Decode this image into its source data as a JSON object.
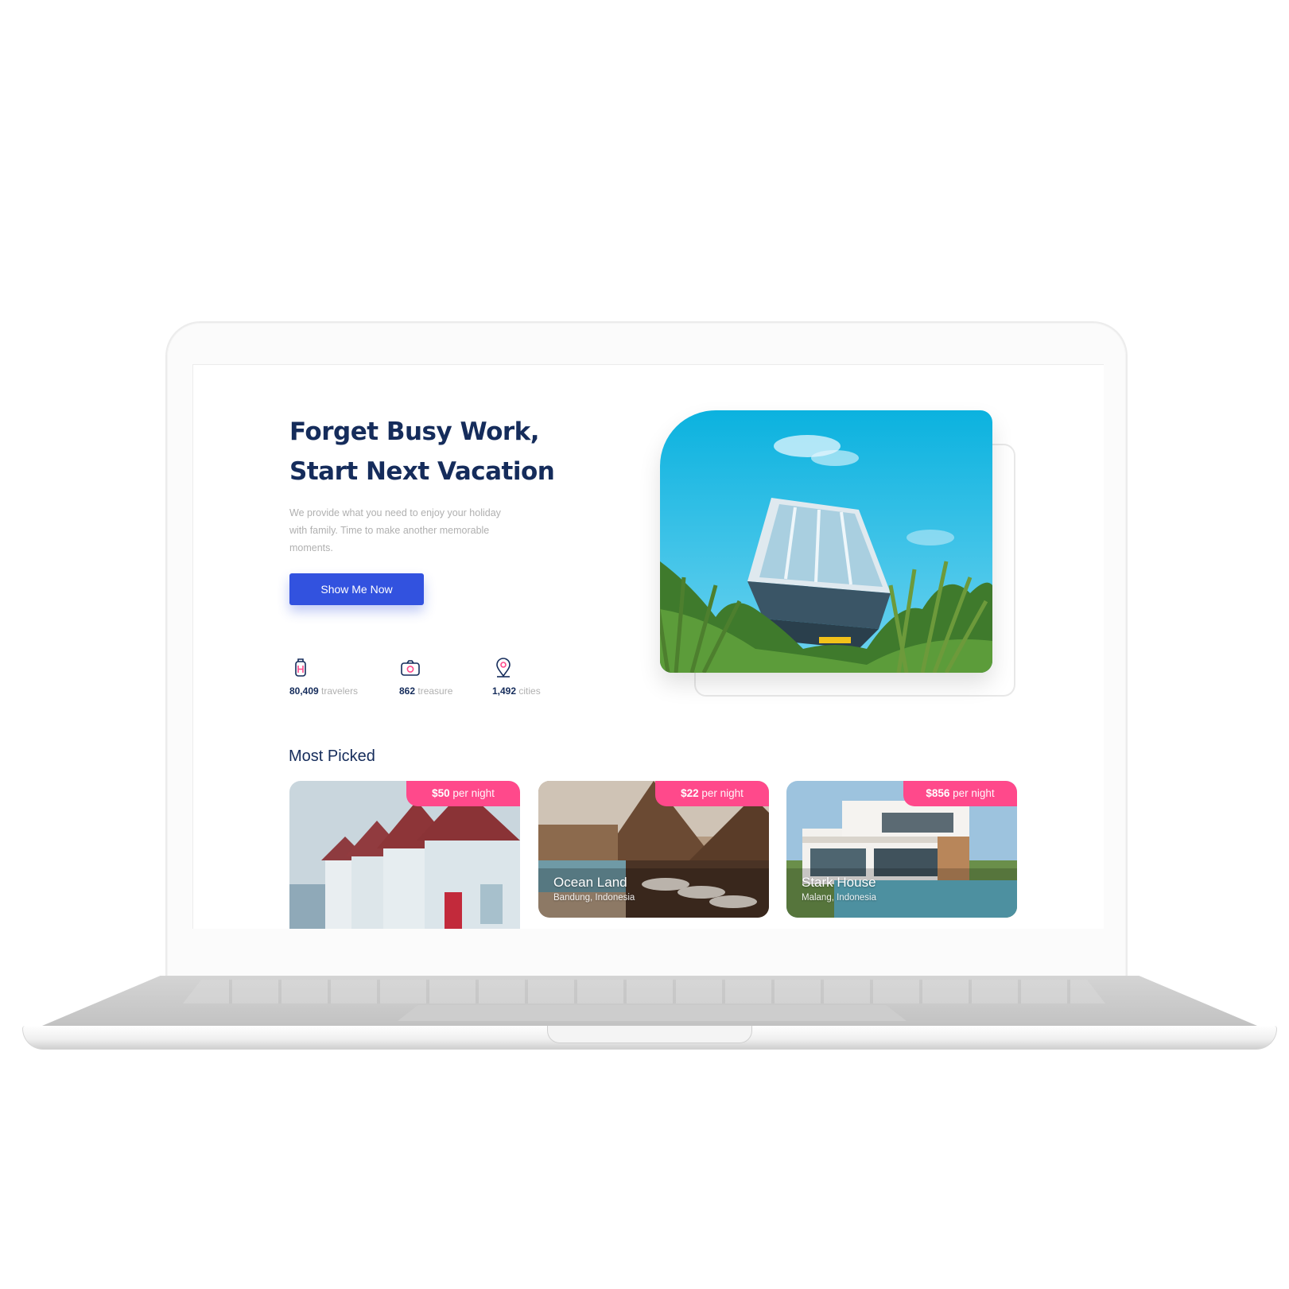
{
  "hero": {
    "title_line1": "Forget Busy Work,",
    "title_line2": "Start Next Vacation",
    "description": "We provide what you need to enjoy your holiday with family. Time to make another memorable moments.",
    "cta_label": "Show Me Now"
  },
  "stats": [
    {
      "value": "80,409",
      "label": "travelers",
      "icon": "luggage-icon"
    },
    {
      "value": "862",
      "label": "treasure",
      "icon": "camera-icon"
    },
    {
      "value": "1,492",
      "label": "cities",
      "icon": "map-pin-icon"
    }
  ],
  "most_picked": {
    "title": "Most Picked",
    "cards": [
      {
        "price": "$50",
        "unit": "per night",
        "name": "",
        "location": ""
      },
      {
        "price": "$22",
        "unit": "per night",
        "name": "Ocean Land",
        "location": "Bandung, Indonesia"
      },
      {
        "price": "$856",
        "unit": "per night",
        "name": "Stark House",
        "location": "Malang, Indonesia"
      }
    ]
  },
  "colors": {
    "primary": "#3252df",
    "heading": "#152c5b",
    "muted": "#b0b0b0",
    "badge": "#ff498b",
    "icon_accent": "#ff498b"
  }
}
